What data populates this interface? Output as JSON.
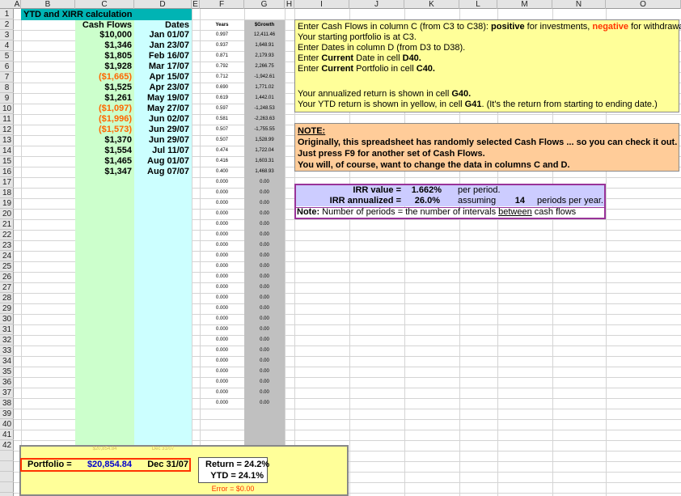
{
  "columns": [
    "A",
    "B",
    "C",
    "D",
    "E",
    "F",
    "G",
    "H",
    "I",
    "J",
    "K",
    "L",
    "M",
    "N",
    "O"
  ],
  "rows": [
    "1",
    "2",
    "3",
    "4",
    "5",
    "6",
    "7",
    "8",
    "9",
    "10",
    "11",
    "12",
    "13",
    "14",
    "15",
    "16",
    "17",
    "18",
    "19",
    "20",
    "21",
    "22",
    "23",
    "24",
    "25",
    "26",
    "27",
    "28",
    "29",
    "30",
    "31",
    "32",
    "33",
    "34",
    "35",
    "36",
    "37",
    "38",
    "39",
    "40",
    "41",
    "42"
  ],
  "title": "YTD and XIRR calculation",
  "headers": {
    "cash_flows": "Cash Flows",
    "dates": "Dates",
    "years": "Years",
    "growth": "$Growth"
  },
  "data_rows": [
    {
      "cf": "$10,000",
      "neg": false,
      "date": "Jan 01/07",
      "years": "0.997",
      "growth": "12,411.46"
    },
    {
      "cf": "$1,346",
      "neg": false,
      "date": "Jan 23/07",
      "years": "0.937",
      "growth": "1,648.91"
    },
    {
      "cf": "$1,805",
      "neg": false,
      "date": "Feb 16/07",
      "years": "0.871",
      "growth": "2,179.93"
    },
    {
      "cf": "$1,928",
      "neg": false,
      "date": "Mar 17/07",
      "years": "0.792",
      "growth": "2,266.75"
    },
    {
      "cf": "($1,665)",
      "neg": true,
      "date": "Apr 15/07",
      "years": "0.712",
      "growth": "-1,942.61"
    },
    {
      "cf": "$1,525",
      "neg": false,
      "date": "Apr 23/07",
      "years": "0.690",
      "growth": "1,771.02"
    },
    {
      "cf": "$1,261",
      "neg": false,
      "date": "May 19/07",
      "years": "0.619",
      "growth": "1,442.01"
    },
    {
      "cf": "($1,097)",
      "neg": true,
      "date": "May 27/07",
      "years": "0.597",
      "growth": "-1,248.53"
    },
    {
      "cf": "($1,996)",
      "neg": true,
      "date": "Jun 02/07",
      "years": "0.581",
      "growth": "-2,263.63"
    },
    {
      "cf": "($1,573)",
      "neg": true,
      "date": "Jun 29/07",
      "years": "0.507",
      "growth": "-1,755.55"
    },
    {
      "cf": "$1,370",
      "neg": false,
      "date": "Jun 29/07",
      "years": "0.507",
      "growth": "1,528.99"
    },
    {
      "cf": "$1,554",
      "neg": false,
      "date": "Jul 11/07",
      "years": "0.474",
      "growth": "1,722.04"
    },
    {
      "cf": "$1,465",
      "neg": false,
      "date": "Aug 01/07",
      "years": "0.416",
      "growth": "1,603.31"
    },
    {
      "cf": "$1,347",
      "neg": false,
      "date": "Aug 07/07",
      "years": "0.400",
      "growth": "1,468.93"
    }
  ],
  "zero_years": "0.000",
  "zero_growth": "0.00",
  "instructions": {
    "line1_pre": "Enter Cash Flows in column C (from C3 to C38): ",
    "line1_pos": "positive",
    "line1_mid": " for investments, ",
    "line1_neg": "negative",
    "line1_post": " for withdrawals.",
    "line2": "Your starting portfolio is at C3.",
    "line3": "Enter Dates in column D (from D3 to D38).",
    "line4_pre": "Enter ",
    "line4_b1": "Current",
    "line4_mid": " Date in cell ",
    "line4_b2": "D40.",
    "line5_pre": "Enter ",
    "line5_b1": "Current",
    "line5_mid": " Portfolio in cell ",
    "line5_b2": "C40.",
    "line6_pre": "Your annualized return is shown in cell ",
    "line6_b": "G40.",
    "line7_pre": "Your YTD return is shown in yellow, in cell ",
    "line7_b": "G41",
    "line7_post": ". (It's the return from starting to ending date.)"
  },
  "note": {
    "heading": "NOTE:",
    "line1": "Originally, this spreadsheet has randomly selected Cash Flows ... so  you can check it out.",
    "line2": "Just press F9 for another set of Cash Flows.",
    "line3": "You will, of course, want to change the data in columns C and D."
  },
  "irr": {
    "value_label": "IRR value =",
    "value": "1.662%",
    "per_period": "per period.",
    "ann_label": "IRR annualized =",
    "ann_value": "26.0%",
    "assuming": "assuming",
    "periods": "14",
    "periods_label": "periods per year.",
    "note_label": "Note:",
    "note_pre": " Number of periods = the number of intervals ",
    "note_u": "between",
    "note_post": " cash flows"
  },
  "bottom": {
    "faint_portfolio": "$20,854.84",
    "faint_date": "Dec 31/07",
    "portfolio_label": "Portfolio =",
    "portfolio_value": "$20,854.84",
    "date_value": "Dec 31/07",
    "return_label": "Return = 24.2%",
    "ytd_label": "YTD = 24.1%",
    "error_label": "Error = $0.00"
  },
  "colors": {
    "teal": "#00b4b4",
    "green": "#ccffcc",
    "cyan": "#ccffff",
    "gray": "#c0c0c0",
    "yellow": "#ffff99",
    "orange": "#ffcc99",
    "lavender": "#ccccff",
    "neg": "#ff6600"
  }
}
